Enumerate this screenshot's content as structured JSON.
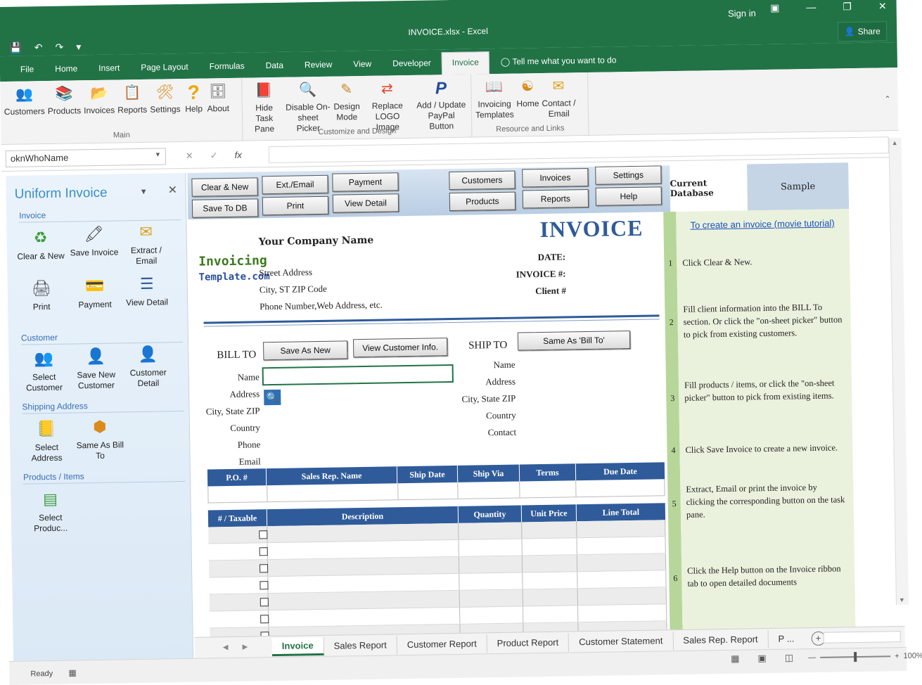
{
  "window": {
    "title": "INVOICE.xlsx  -  Excel",
    "signin": "Sign in",
    "share": "Share"
  },
  "tabs": [
    "File",
    "Home",
    "Insert",
    "Page Layout",
    "Formulas",
    "Data",
    "Review",
    "View",
    "Developer",
    "Invoice"
  ],
  "tellme": "Tell me what you want to do",
  "ribbon": {
    "main": {
      "label": "Main",
      "buttons": [
        "Customers",
        "Products",
        "Invoices",
        "Reports",
        "Settings",
        "Help",
        "About"
      ]
    },
    "customize": {
      "label": "Customize and Design",
      "buttons": [
        [
          "Hide Task",
          "Pane"
        ],
        [
          "Disable On-",
          "sheet Picker"
        ],
        [
          "Design",
          "Mode"
        ],
        [
          "Replace",
          "LOGO Image"
        ],
        [
          "Add / Update",
          "PayPal Button"
        ]
      ]
    },
    "resource": {
      "label": "Resource and Links",
      "buttons": [
        [
          "Invoicing",
          "Templates"
        ],
        [
          "Home",
          ""
        ],
        [
          "Contact /",
          "Email"
        ]
      ]
    }
  },
  "formula_bar": {
    "namebox": "oknWhoName",
    "value": ""
  },
  "taskpane": {
    "title": "Uniform Invoice",
    "sections": {
      "invoice": "Invoice",
      "customer": "Customer",
      "shipping": "Shipping Address",
      "products": "Products / Items"
    },
    "invoice_items": [
      [
        "Clear & New",
        ""
      ],
      [
        "Save Invoice",
        ""
      ],
      [
        "Extract /",
        "Email"
      ],
      [
        "Print",
        ""
      ],
      [
        "Payment",
        ""
      ],
      [
        "View Detail",
        ""
      ]
    ],
    "customer_items": [
      [
        "Select",
        "Customer"
      ],
      [
        "Save New",
        "Customer"
      ],
      [
        "Customer",
        "Detail"
      ]
    ],
    "shipping_items": [
      [
        "Select",
        "Address"
      ],
      [
        "Same As Bill",
        "To"
      ]
    ],
    "product_items": [
      [
        "Select",
        "Produc..."
      ]
    ]
  },
  "sheet_buttons": {
    "clear_new": "Clear & New",
    "ext_email": "Ext./Email",
    "payment": "Payment",
    "save_db": "Save To DB",
    "print": "Print",
    "view_detail": "View Detail",
    "customers": "Customers",
    "invoices": "Invoices",
    "settings": "Settings",
    "products": "Products",
    "reports": "Reports",
    "help": "Help",
    "current_db_label": "Current Database",
    "current_db_value": "Sample"
  },
  "invoice": {
    "company": "Your Company Name",
    "title": "INVOICE",
    "address": [
      "Street Address",
      "City, ST  ZIP Code",
      "Phone Number,Web Address, etc."
    ],
    "logo": [
      "Invoicing",
      "Template.com"
    ],
    "date_label": "DATE:",
    "invoice_no_label": "INVOICE #:",
    "client_label": "Client #",
    "bill_to": "BILL TO",
    "ship_to": "SHIP TO",
    "save_as_new": "Save As New",
    "view_customer": "View Customer Info.",
    "same_as_bill": "Same As 'Bill To'",
    "bill_fields": [
      "Name",
      "Address",
      "City, State ZIP",
      "Country",
      "Phone",
      "Email"
    ],
    "ship_fields": [
      "Name",
      "Address",
      "City, State ZIP",
      "Country",
      "Contact"
    ],
    "order_headers": [
      "P.O. #",
      "Sales Rep. Name",
      "Ship Date",
      "Ship Via",
      "Terms",
      "Due Date"
    ],
    "item_headers": [
      "# / Taxable",
      "Description",
      "Quantity",
      "Unit Price",
      "Line Total"
    ]
  },
  "instructions": {
    "link": "To create an invoice (movie tutorial)",
    "steps": [
      {
        "num": "1",
        "text": "Click Clear & New."
      },
      {
        "num": "2",
        "text": "Fill client information into the BILL To section. Or click the \"on-sheet picker\" button to pick from existing customers."
      },
      {
        "num": "3",
        "text": "Fill products / items, or click the \"on-sheet picker\" button to pick from existing items."
      },
      {
        "num": "4",
        "text": "Click Save Invoice to create a new invoice."
      },
      {
        "num": "5",
        "text": "Extract, Email or print the invoice by clicking the corresponding button on the task pane."
      },
      {
        "num": "6",
        "text": "Click the Help button on the Invoice ribbon tab to open detailed documents"
      }
    ]
  },
  "sheet_tabs": [
    "Invoice",
    "Sales Report",
    "Customer Report",
    "Product Report",
    "Customer Statement",
    "Sales Rep. Report",
    "P ..."
  ],
  "status": {
    "ready": "Ready",
    "zoom": "100%"
  }
}
